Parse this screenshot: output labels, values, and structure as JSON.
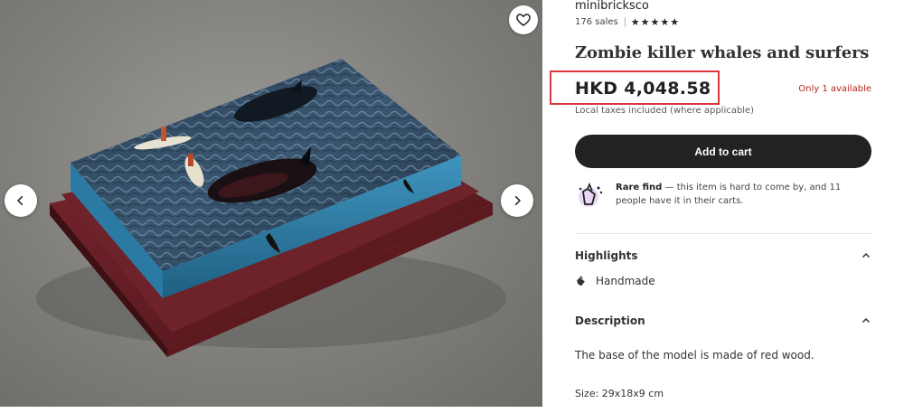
{
  "gallery": {
    "image_alt": "Resin diorama of killer whales and surfers on a red wood base",
    "favorite_icon": "heart-icon",
    "prev_icon": "chevron-left-icon",
    "next_icon": "chevron-right-icon"
  },
  "listing": {
    "shop_name": "minibricksco",
    "sales": "176 sales",
    "rating_stars": 5,
    "title": "Zombie killer whales and surfers",
    "price": "HKD 4,048.58",
    "stock": "Only 1 available",
    "tax_note": "Local taxes included (where applicable)",
    "add_to_cart": "Add to cart",
    "rare_find_bold": "Rare find",
    "rare_find_text": " — this item is hard to come by, and 11 people have it in their carts."
  },
  "highlights": {
    "heading": "Highlights",
    "items": [
      {
        "icon": "hand-icon",
        "label": "Handmade"
      }
    ]
  },
  "description": {
    "heading": "Description",
    "text": "The base of the model is made of red wood.",
    "size": "Size: 29x18x9 cm"
  },
  "colors": {
    "accent_red": "#d9363e",
    "stock_red": "#b3261e",
    "button_dark": "#222222",
    "resin_blue": "#2f7fa8",
    "wood_red": "#6b1f24"
  }
}
